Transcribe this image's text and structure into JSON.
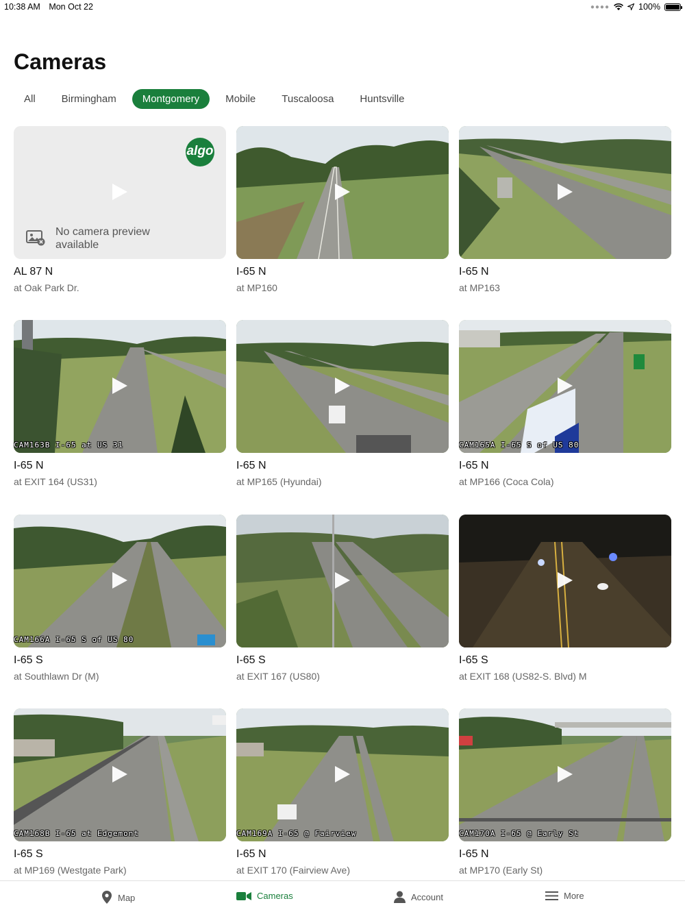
{
  "status": {
    "time": "10:38 AM",
    "date": "Mon Oct 22",
    "battery": "100%"
  },
  "title": "Cameras",
  "tabs": [
    {
      "label": "All",
      "active": false
    },
    {
      "label": "Birmingham",
      "active": false
    },
    {
      "label": "Montgomery",
      "active": true
    },
    {
      "label": "Mobile",
      "active": false
    },
    {
      "label": "Tuscaloosa",
      "active": false
    },
    {
      "label": "Huntsville",
      "active": false
    }
  ],
  "placeholder": {
    "logo_text": "algo",
    "message": "No camera preview available"
  },
  "cameras": [
    {
      "title": "AL 87 N",
      "subtitle": "at Oak Park Dr.",
      "caption": "",
      "preview": false,
      "scene": "none"
    },
    {
      "title": "I-65 N",
      "subtitle": "at MP160",
      "caption": "",
      "preview": true,
      "scene": "day"
    },
    {
      "title": "I-65 N",
      "subtitle": "at MP163",
      "caption": "",
      "preview": true,
      "scene": "day"
    },
    {
      "title": "I-65 N",
      "subtitle": "at EXIT 164 (US31)",
      "caption": "CAM163B I-65 at US 31",
      "preview": true,
      "scene": "day"
    },
    {
      "title": "I-65 N",
      "subtitle": "at MP165 (Hyundai)",
      "caption": "",
      "preview": true,
      "scene": "day"
    },
    {
      "title": "I-65 N",
      "subtitle": "at MP166 (Coca Cola)",
      "caption": "CAM165A I-65 S of US 80",
      "preview": true,
      "scene": "day"
    },
    {
      "title": "I-65 S",
      "subtitle": "at Southlawn Dr (M)",
      "caption": "CAM166A I-65 S of US 80",
      "preview": true,
      "scene": "day"
    },
    {
      "title": "I-65 S",
      "subtitle": "at EXIT 167 (US80)",
      "caption": "",
      "preview": true,
      "scene": "dusk"
    },
    {
      "title": "I-65 S",
      "subtitle": "at EXIT 168 (US82-S. Blvd) M",
      "caption": "",
      "preview": true,
      "scene": "night"
    },
    {
      "title": "I-65 S",
      "subtitle": "at MP169 (Westgate Park)",
      "caption": "CAM168B I-65 at Edgemont",
      "preview": true,
      "scene": "day"
    },
    {
      "title": "I-65 N",
      "subtitle": "at EXIT 170 (Fairview Ave)",
      "caption": "CAM169A I-65 @ Fairview",
      "preview": true,
      "scene": "day"
    },
    {
      "title": "I-65 N",
      "subtitle": "at MP170 (Early St)",
      "caption": "CAM170A I-65 @ Early St",
      "preview": true,
      "scene": "day"
    }
  ],
  "nav": [
    {
      "label": "Map",
      "icon": "map-pin-icon",
      "active": false
    },
    {
      "label": "Cameras",
      "icon": "video-camera-icon",
      "active": true
    },
    {
      "label": "Account",
      "icon": "person-icon",
      "active": false
    },
    {
      "label": "More",
      "icon": "menu-icon",
      "active": false
    }
  ],
  "colors": {
    "accent": "#1a7f3c"
  }
}
